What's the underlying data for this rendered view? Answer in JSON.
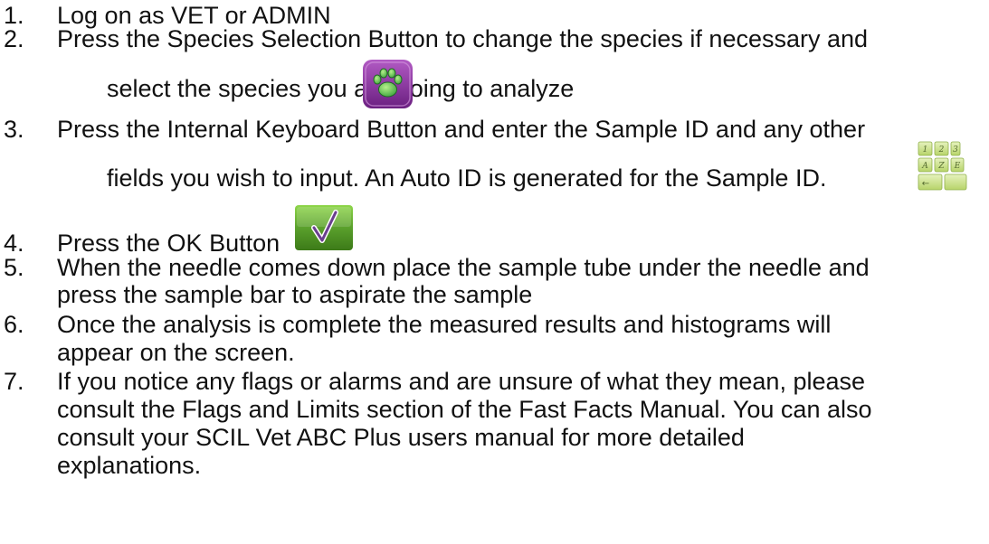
{
  "steps": [
    {
      "num": "1.",
      "lines": [
        "Log on as VET or ADMIN"
      ]
    },
    {
      "num": "2.",
      "lines": [
        "Press the Species Selection Button to change the species if necessary and",
        "select the species you are going to analyze"
      ],
      "icon": "paw-icon"
    },
    {
      "num": "3.",
      "lines": [
        "Press the Internal Keyboard Button and enter the Sample ID and any other",
        "fields you wish to input. An Auto ID is generated for the Sample ID."
      ],
      "icon": "keyboard-icon"
    },
    {
      "num": "4.",
      "lines": [
        "Press the OK Button"
      ],
      "icon": "checkmark-icon"
    },
    {
      "num": "5.",
      "lines": [
        "When the needle comes down place the sample tube under the needle and",
        "press the sample bar to aspirate the sample"
      ]
    },
    {
      "num": "6.",
      "lines": [
        "Once the analysis is complete the measured results and histograms will",
        "appear on the screen."
      ]
    },
    {
      "num": "7.",
      "lines": [
        "If you notice any flags or alarms and are unsure of what they mean, please",
        "consult the Flags and Limits section of the Fast Facts Manual. You can also",
        "consult your SCIL Vet ABC Plus users manual for more detailed",
        "explanations."
      ]
    }
  ],
  "keyboard_keys": [
    "1",
    "2",
    "3",
    "A",
    "Z",
    "E",
    "←"
  ],
  "colors": {
    "paw_background": "#8a2f9e",
    "paw_foreground": "#3fbf4a",
    "keyboard_key": "#c9e08a",
    "ok_background": "#5aa02c",
    "text": "#111111"
  }
}
